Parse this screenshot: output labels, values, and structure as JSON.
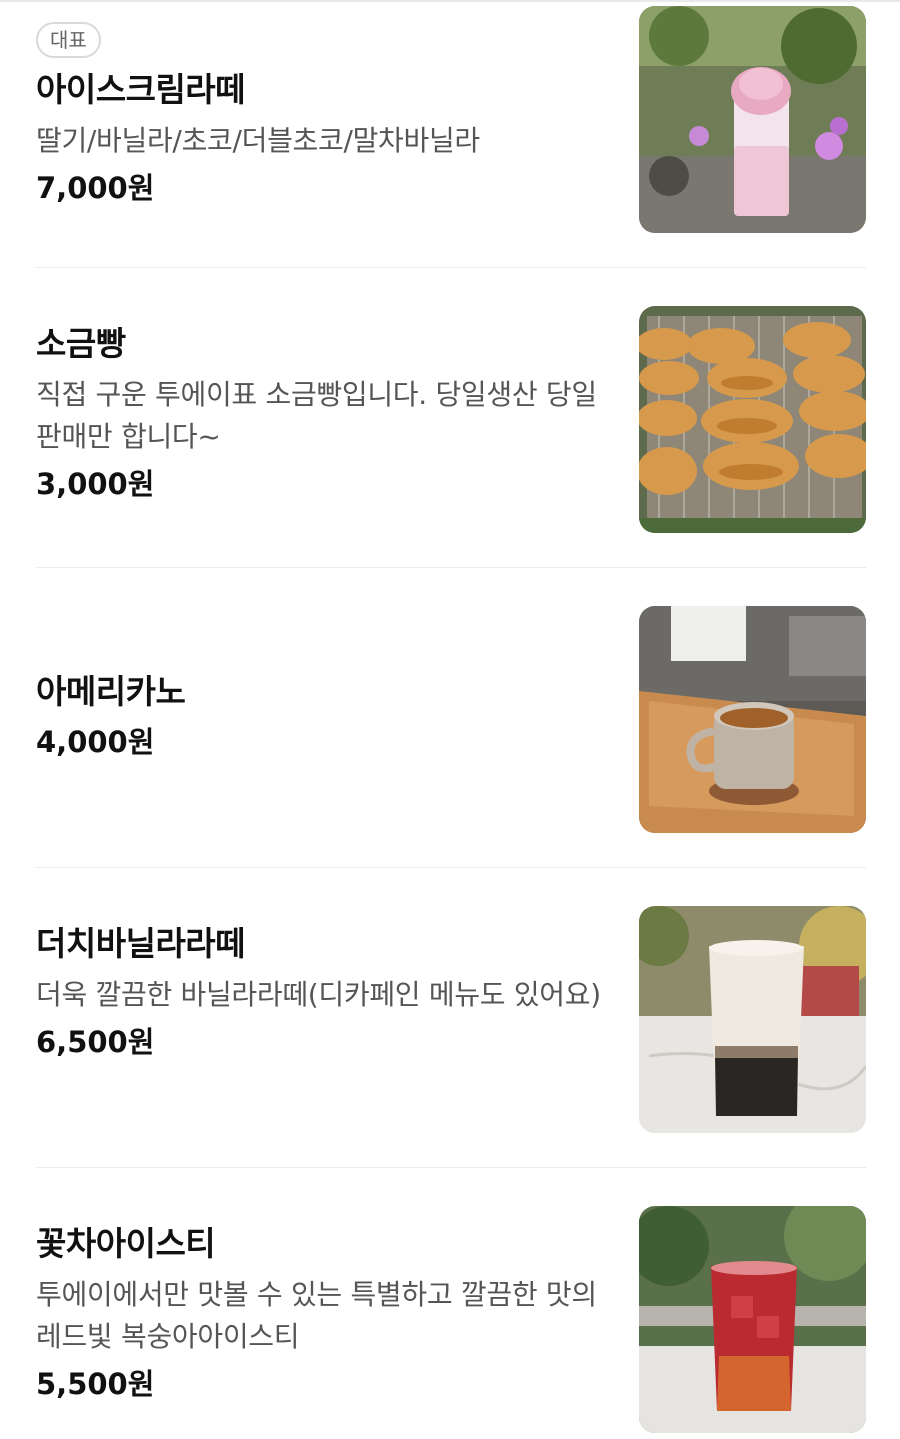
{
  "menu": {
    "items": [
      {
        "badge": "대표",
        "name": "아이스크림라떼",
        "desc": "딸기/바닐라/초코/더블초코/말차바닐라",
        "price": "7,000원",
        "image": "ice-cream-latte-photo"
      },
      {
        "name": "소금빵",
        "desc": "직접 구운 투에이표 소금빵입니다. 당일생산 당일판매만 합니다~",
        "price": "3,000원",
        "image": "salt-bread-photo"
      },
      {
        "name": "아메리카노",
        "price": "4,000원",
        "image": "americano-photo"
      },
      {
        "name": "더치바닐라라떼",
        "desc": "더욱 깔끔한 바닐라라떼(디카페인 메뉴도 있어요)",
        "price": "6,500원",
        "image": "dutch-vanilla-latte-photo"
      },
      {
        "name": "꽃차아이스티",
        "desc": "투에이에서만 맛볼 수 있는 특별하고 깔끔한 맛의 레드빛 복숭아아이스티",
        "price": "5,500원",
        "image": "flower-tea-iced-tea-photo"
      }
    ]
  }
}
